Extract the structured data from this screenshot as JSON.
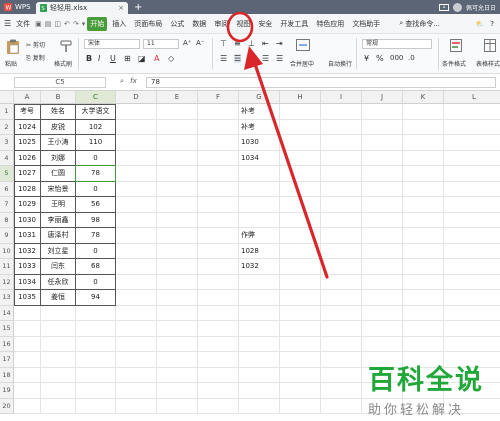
{
  "titlebar": {
    "app": "WPS",
    "file_tab": "轻轻用.xlsx",
    "close": "×",
    "new_tab": "+",
    "badge": "1",
    "user": "佩可允日日"
  },
  "menubar": {
    "file": "文件",
    "items": [
      "开始",
      "插入",
      "页面布局",
      "公式",
      "数据",
      "审阅",
      "视图",
      "安全",
      "开发工具",
      "特色应用",
      "文档助手"
    ],
    "active_index": 0,
    "search": "查找命令...",
    "right_items": [
      "⛅",
      "?"
    ]
  },
  "ribbon": {
    "paste": "粘贴",
    "cut": "剪切",
    "copy": "复制",
    "format_painter": "格式刷",
    "font_name": "宋体",
    "font_size": "11",
    "merge_center": "合并居中",
    "wrap_text": "自动换行",
    "number_format": "常规",
    "conditional_format": "条件格式",
    "table_style": "表格样式"
  },
  "formula": {
    "name_box": "C5",
    "fx": "fx",
    "value": "78"
  },
  "grid": {
    "columns": [
      "A",
      "B",
      "C",
      "D",
      "E",
      "F",
      "G",
      "H",
      "I",
      "J",
      "K",
      "L"
    ],
    "selected_col": "C",
    "selected_row": 5,
    "rows": [
      [
        "考号",
        "姓名",
        "大学语文",
        "",
        "",
        "",
        "补考",
        "",
        "",
        "",
        "",
        ""
      ],
      [
        "1024",
        "皮锐",
        "102",
        "",
        "",
        "",
        "补考",
        "",
        "",
        "",
        "",
        ""
      ],
      [
        "1025",
        "王小涛",
        "110",
        "",
        "",
        "",
        "1030",
        "",
        "",
        "",
        "",
        ""
      ],
      [
        "1026",
        "刘娜",
        "0",
        "",
        "",
        "",
        "1034",
        "",
        "",
        "",
        "",
        ""
      ],
      [
        "1027",
        "仁圆",
        "78",
        "",
        "",
        "",
        "",
        "",
        "",
        "",
        "",
        ""
      ],
      [
        "1028",
        "宋怡景",
        "0",
        "",
        "",
        "",
        "",
        "",
        "",
        "",
        "",
        ""
      ],
      [
        "1029",
        "王明",
        "56",
        "",
        "",
        "",
        "",
        "",
        "",
        "",
        "",
        ""
      ],
      [
        "1030",
        "李丽鑫",
        "98",
        "",
        "",
        "",
        "",
        "",
        "",
        "",
        "",
        ""
      ],
      [
        "1031",
        "唐泽村",
        "78",
        "",
        "",
        "",
        "作弊",
        "",
        "",
        "",
        "",
        ""
      ],
      [
        "1032",
        "刘立星",
        "0",
        "",
        "",
        "",
        "1028",
        "",
        "",
        "",
        "",
        ""
      ],
      [
        "1033",
        "闫东",
        "68",
        "",
        "",
        "",
        "1032",
        "",
        "",
        "",
        "",
        ""
      ],
      [
        "1034",
        "任永欣",
        "0",
        "",
        "",
        "",
        "",
        "",
        "",
        "",
        "",
        ""
      ],
      [
        "1035",
        "姜恒",
        "94",
        "",
        "",
        "",
        "",
        "",
        "",
        "",
        "",
        ""
      ],
      [
        "",
        "",
        "",
        "",
        "",
        "",
        "",
        "",
        "",
        "",
        "",
        ""
      ],
      [
        "",
        "",
        "",
        "",
        "",
        "",
        "",
        "",
        "",
        "",
        "",
        ""
      ],
      [
        "",
        "",
        "",
        "",
        "",
        "",
        "",
        "",
        "",
        "",
        "",
        ""
      ],
      [
        "",
        "",
        "",
        "",
        "",
        "",
        "",
        "",
        "",
        "",
        "",
        ""
      ],
      [
        "",
        "",
        "",
        "",
        "",
        "",
        "",
        "",
        "",
        "",
        "",
        ""
      ],
      [
        "",
        "",
        "",
        "",
        "",
        "",
        "",
        "",
        "",
        "",
        "",
        ""
      ],
      [
        "",
        "",
        "",
        "",
        "",
        "",
        "",
        "",
        "",
        "",
        "",
        ""
      ]
    ]
  },
  "watermark": {
    "title": "百科全说",
    "subtitle": "助你轻松解决"
  },
  "colors": {
    "accent": "#4a9b3a",
    "annotation": "#d9262a",
    "watermark": "#22a83a"
  }
}
